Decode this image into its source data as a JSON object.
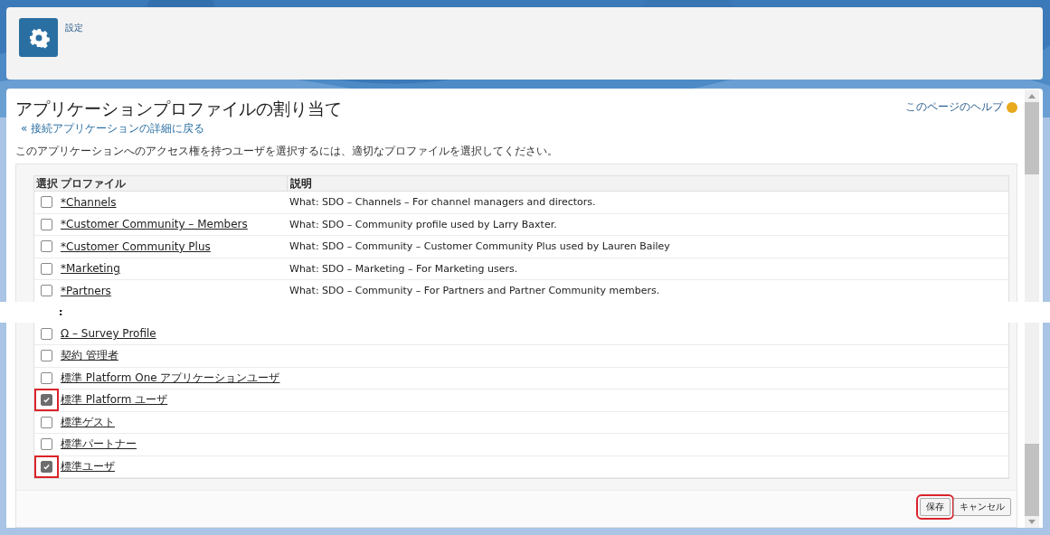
{
  "header": {
    "breadcrumb": "設定"
  },
  "page": {
    "title": "アプリケーションプロファイルの割り当て",
    "back_link": "« 接続アプリケーションの詳細に戻る",
    "help_link": "このページのヘルプ",
    "instruction": "このアプリケーションへのアクセス権を持つユーザを選択するには、適切なプロファイルを選択してください。"
  },
  "table": {
    "columns": [
      "選択",
      "プロファイル",
      "説明"
    ],
    "rows": [
      {
        "profile": "*Channels",
        "description": "What: SDO – Channels – For channel managers and directors.",
        "checked": false,
        "highlighted": false
      },
      {
        "profile": "*Customer Community – Members",
        "description": "What: SDO – Community profile used by Larry Baxter.",
        "checked": false,
        "highlighted": false
      },
      {
        "profile": "*Customer Community Plus",
        "description": "What: SDO – Community – Customer Community Plus used by Lauren Bailey",
        "checked": false,
        "highlighted": false
      },
      {
        "profile": "*Marketing",
        "description": "What: SDO – Marketing – For Marketing users.",
        "checked": false,
        "highlighted": false
      },
      {
        "profile": "*Partners",
        "description": "What: SDO – Community – For Partners and Partner Community members.",
        "checked": false,
        "highlighted": false
      },
      {
        "kind": "gap",
        "text": ":"
      },
      {
        "profile": "Ω – Survey Profile",
        "checked": false,
        "highlighted": false
      },
      {
        "profile": "契約 管理者",
        "checked": false,
        "highlighted": false
      },
      {
        "profile": "標準 Platform One アプリケーションユーザ",
        "checked": false,
        "highlighted": false
      },
      {
        "profile": "標準 Platform ユーザ",
        "checked": true,
        "highlighted": true
      },
      {
        "profile": "標準ゲスト",
        "checked": false,
        "highlighted": false
      },
      {
        "profile": "標準パートナー",
        "checked": false,
        "highlighted": false
      },
      {
        "profile": "標準ユーザ",
        "checked": true,
        "highlighted": true
      }
    ]
  },
  "buttons": [
    {
      "label": "保存",
      "highlighted": true
    },
    {
      "label": "キャンセル",
      "highlighted": false
    }
  ]
}
